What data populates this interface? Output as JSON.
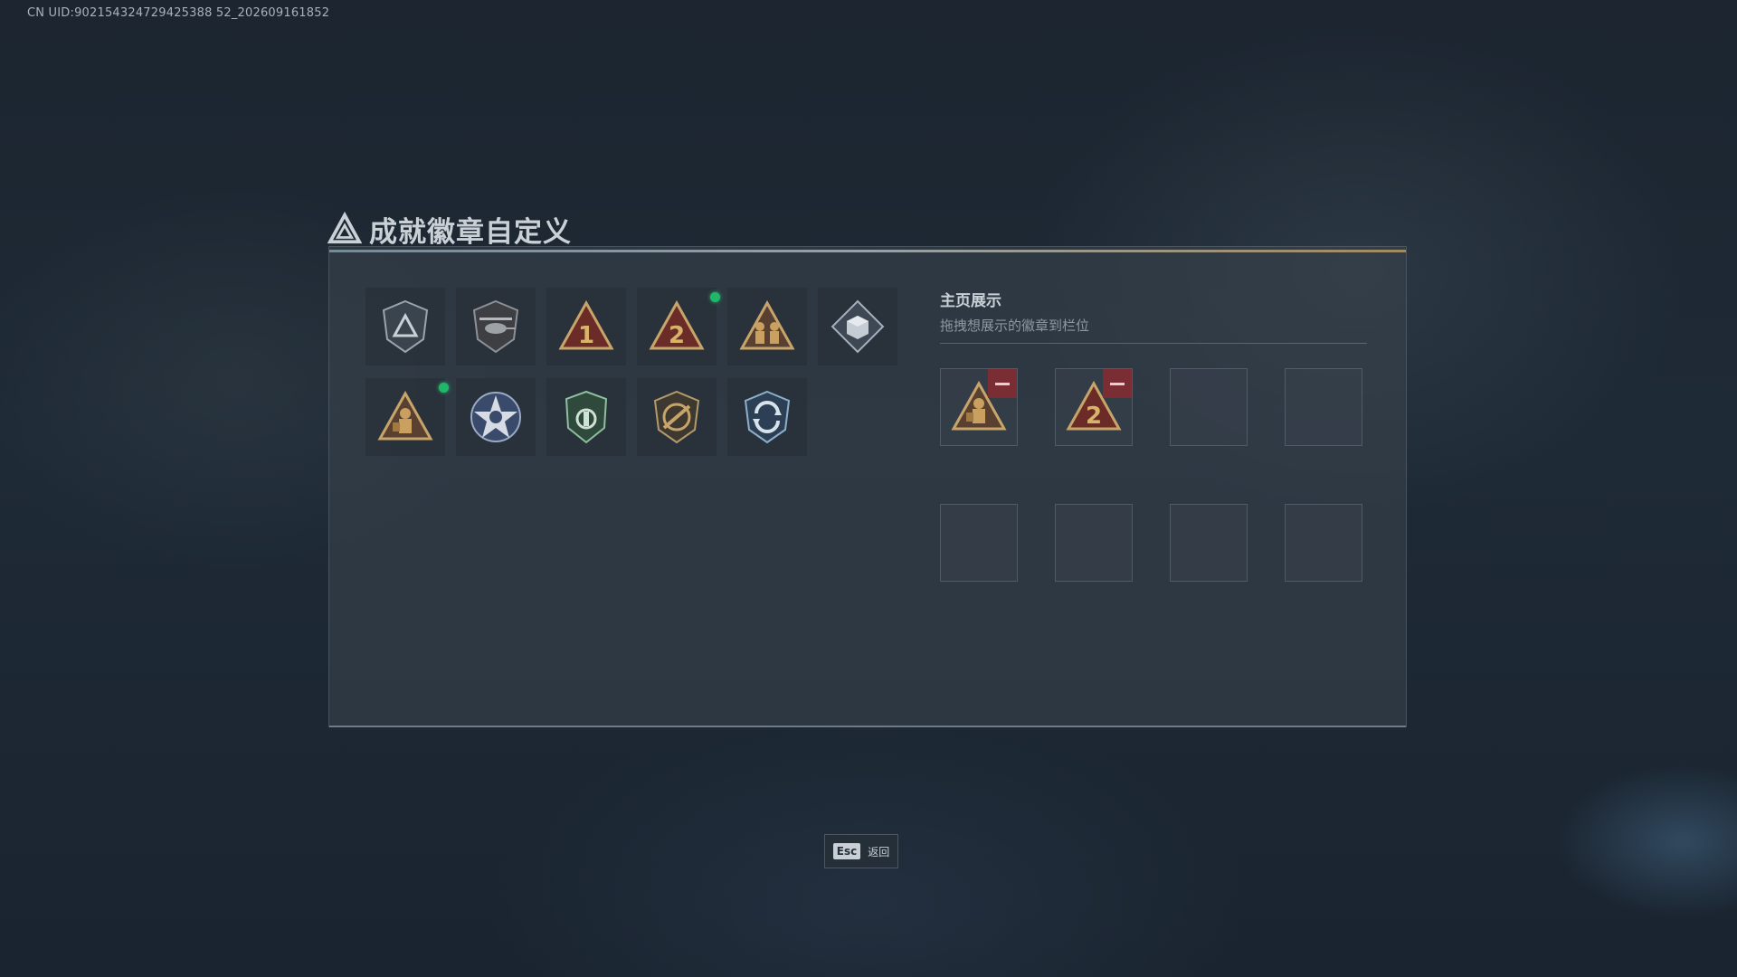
{
  "uid_text": "CN UID:902154324729425388 52_202609161852",
  "title": "成就徽章自定义",
  "badges": [
    {
      "icon": "delta-shield-badge-icon",
      "selected": false
    },
    {
      "icon": "helicopter-badge-icon",
      "selected": false
    },
    {
      "icon": "rank-1-triangle-badge-icon",
      "selected": false
    },
    {
      "icon": "rank-2-triangle-badge-icon",
      "selected": true
    },
    {
      "icon": "soldiers-triangle-badge-icon",
      "selected": false
    },
    {
      "icon": "diamond-cube-badge-icon",
      "selected": false
    },
    {
      "icon": "soldier-triangle-badge-icon",
      "selected": true
    },
    {
      "icon": "star-skull-badge-icon",
      "selected": false
    },
    {
      "icon": "green-shield-badge-icon",
      "selected": false
    },
    {
      "icon": "rifle-shield-badge-icon",
      "selected": false
    },
    {
      "icon": "arrows-shield-badge-icon",
      "selected": false
    }
  ],
  "showcase": {
    "title": "主页展示",
    "subtitle": "拖拽想展示的徽章到栏位",
    "slots": [
      {
        "icon": "soldier-triangle-badge-icon",
        "filled": true
      },
      {
        "icon": "rank-2-triangle-badge-icon",
        "filled": true
      },
      {
        "filled": false
      },
      {
        "filled": false
      },
      {
        "filled": false
      },
      {
        "filled": false
      },
      {
        "filled": false
      },
      {
        "filled": false
      }
    ]
  },
  "footer": {
    "key": "Esc",
    "label": "返回"
  },
  "colors": {
    "accent_gold": "#c7a56a",
    "badge_red": "#7a2d33",
    "selected_dot": "#1fb86a"
  }
}
